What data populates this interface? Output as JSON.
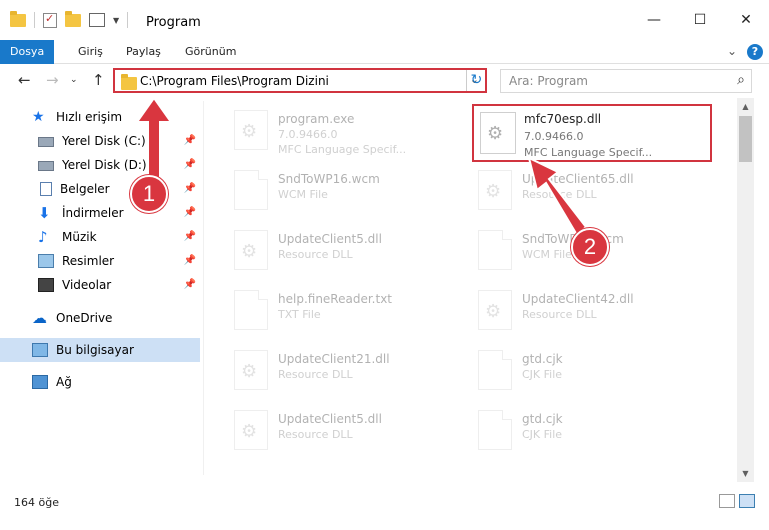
{
  "window": {
    "title": "Program",
    "minimize": "—",
    "maximize": "☐",
    "close": "✕"
  },
  "ribbon": {
    "tabs": [
      "Dosya",
      "Giriş",
      "Paylaş",
      "Görünüm"
    ]
  },
  "address": {
    "path": "C:\\Program Files\\Program Dizini",
    "search_placeholder": "Ara: Program"
  },
  "nav": {
    "quick_access": "Hızlı erişim",
    "items": [
      {
        "label": "Yerel Disk (C:)",
        "icon": "disk-icon",
        "pinned": true
      },
      {
        "label": "Yerel Disk (D:)",
        "icon": "disk-icon",
        "pinned": true
      },
      {
        "label": "Belgeler",
        "icon": "documents-icon",
        "pinned": true
      },
      {
        "label": "İndirmeler",
        "icon": "downloads-icon",
        "pinned": true
      },
      {
        "label": "Müzik",
        "icon": "music-icon",
        "pinned": true
      },
      {
        "label": "Resimler",
        "icon": "pictures-icon",
        "pinned": true
      },
      {
        "label": "Videolar",
        "icon": "videos-icon",
        "pinned": true
      }
    ],
    "onedrive": "OneDrive",
    "this_pc": "Bu bilgisayar",
    "network": "Ağ"
  },
  "files": [
    {
      "name": "program.exe",
      "sub1": "7.0.9466.0",
      "sub2": "MFC Language Specif...",
      "icon": "exe-icon"
    },
    {
      "name": "mfc70esp.dll",
      "sub1": "7.0.9466.0",
      "sub2": "MFC Language Specif...",
      "icon": "dll-icon"
    },
    {
      "name": "SndToWP16.wcm",
      "sub1": "WCM File",
      "icon": "blank-file-icon"
    },
    {
      "name": "UpdateClient65.dll",
      "sub1": "Resource DLL",
      "icon": "dll-icon"
    },
    {
      "name": "UpdateClient5.dll",
      "sub1": "Resource DLL",
      "icon": "dll-icon"
    },
    {
      "name": "SndToWP16.wcm",
      "sub1": "WCM File",
      "icon": "blank-file-icon"
    },
    {
      "name": "help.fineReader.txt",
      "sub1": "TXT File",
      "icon": "blank-file-icon"
    },
    {
      "name": "UpdateClient42.dll",
      "sub1": "Resource DLL",
      "icon": "dll-icon"
    },
    {
      "name": "UpdateClient21.dll",
      "sub1": "Resource DLL",
      "icon": "dll-icon"
    },
    {
      "name": "gtd.cjk",
      "sub1": "CJK File",
      "icon": "blank-file-icon"
    },
    {
      "name": "UpdateClient5.dll",
      "sub1": "Resource DLL",
      "icon": "dll-icon"
    },
    {
      "name": "gtd.cjk",
      "sub1": "CJK File",
      "icon": "blank-file-icon"
    }
  ],
  "status": {
    "count": "164 öğe"
  },
  "callouts": [
    "1",
    "2"
  ],
  "colors": {
    "accent": "#1979ca",
    "highlight": "#d1343f",
    "selected": "#cde0f5"
  }
}
